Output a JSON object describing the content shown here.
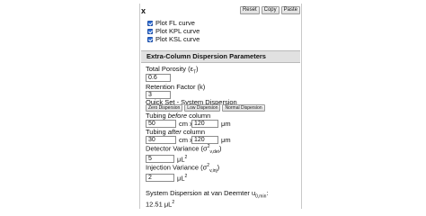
{
  "panel": {
    "close_label": "x",
    "buttons": {
      "reset": "Reset",
      "copy": "Copy",
      "paste": "Paste"
    },
    "checkboxes": [
      {
        "label": "Plot FL curve",
        "checked": true
      },
      {
        "label": "Plot KPL curve",
        "checked": true
      },
      {
        "label": "Plot KSL curve",
        "checked": true
      }
    ]
  },
  "section": {
    "title": "Extra-Column Dispersion Parameters",
    "porosity": {
      "label": "Total Porosity (ε",
      "sub": "T",
      "tail": ")",
      "value": "0.6"
    },
    "retention": {
      "label": "Retention Factor (k)",
      "value": "3"
    },
    "quick_set": {
      "label": "Quick Set - System Dispersion",
      "buttons": [
        "Zero Dispersion",
        "Low Dispersion",
        "Normal Dispersion"
      ]
    },
    "tubing_before": {
      "label_pre": "Tubing ",
      "label_em": "before",
      "label_post": " column",
      "length": "50",
      "times": "cm x",
      "diameter": "120",
      "unit": "μm"
    },
    "tubing_after": {
      "label_pre": "Tubing ",
      "label_em": "after",
      "label_post": " column",
      "length": "30",
      "times": "cm x",
      "diameter": "120",
      "unit": "μm"
    },
    "detector": {
      "label": "Detector Variance (σ",
      "sup": "2",
      "sub": "v,det",
      "tail": ")",
      "value": "5",
      "unit": "μL",
      "unit_sup": "2"
    },
    "injection": {
      "label": "Injection Variance (σ",
      "sup": "2",
      "sub": "v,inj",
      "tail": ")",
      "value": "2",
      "unit": "μL",
      "unit_sup": "2"
    },
    "result": {
      "label": "System Dispersion at van Deemter u",
      "sub": "0,min",
      "tail": ":",
      "value": "12.51 μL",
      "value_sup": "2"
    }
  }
}
